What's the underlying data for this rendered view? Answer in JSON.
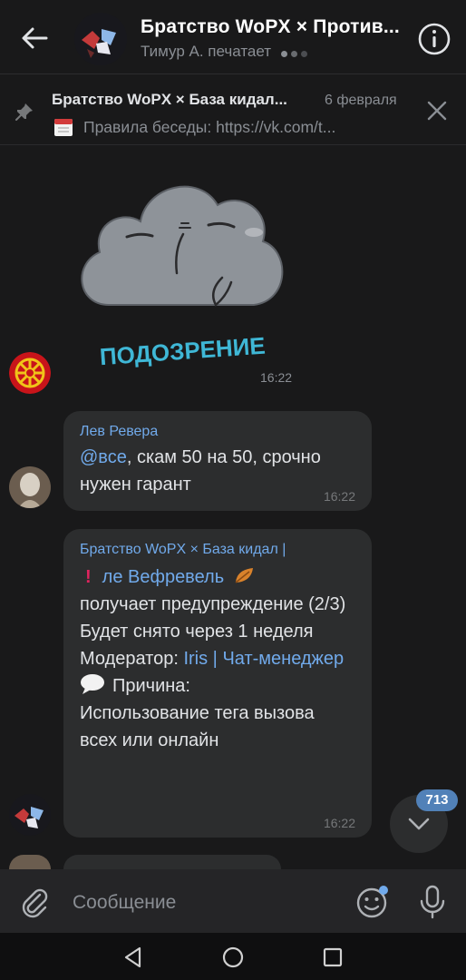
{
  "header": {
    "title": "Братство WoPX × Против...",
    "status": "Тимур А. печатает"
  },
  "pinned": {
    "title": "Братство WoPX × База кидал...",
    "date": "6 февраля",
    "text": "Правила беседы: https://vk.com/t..."
  },
  "messages": [
    {
      "type": "sticker",
      "sticker_caption": "ПОДОЗРЕНИЕ",
      "time": "16:22"
    },
    {
      "sender": "Лев Ревера",
      "mention": "@все",
      "text_rest": ", скам 50 на 50, срочно нужен гарант",
      "time": "16:22"
    },
    {
      "sender": "Братство WoPX × База кидал |",
      "warn_name": "ле Вефревель",
      "line2": "получает предупреждение (2/3)",
      "line3": "Будет снято через 1 неделя",
      "moderator_label": "Модератор:",
      "moderator_link": "Iris | Чат-менеджер",
      "reason_label": "Причина:",
      "reason_text": "Использование тега вызова всех или онлайн",
      "time": "16:22"
    }
  ],
  "scroll": {
    "unread_count": "713"
  },
  "composer": {
    "placeholder": "Сообщение"
  },
  "colors": {
    "background": "#19191a",
    "bubble": "#2c2d2e",
    "accent": "#71aaeb",
    "badge": "#5181b8"
  },
  "icons": [
    "back-arrow-icon",
    "info-icon",
    "pin-icon",
    "calendar-icon",
    "close-icon",
    "chevron-down-icon",
    "paperclip-icon",
    "emoji-icon",
    "microphone-icon",
    "nav-back-icon",
    "nav-home-icon",
    "nav-recents-icon"
  ]
}
